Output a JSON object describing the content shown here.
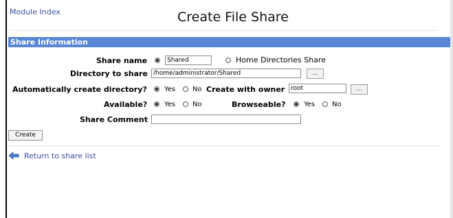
{
  "header": {
    "module_index_label": "Module Index",
    "title": "Create File Share"
  },
  "section": {
    "title": "Share Information"
  },
  "form": {
    "share_name": {
      "label": "Share name",
      "radio_named_selected": true,
      "value": "Shared",
      "home_dirs_label": "Home Directories Share"
    },
    "directory": {
      "label": "Directory to share",
      "value": "/home/administrator/Shared",
      "browse_label": "..."
    },
    "auto_create": {
      "label": "Automatically create directory?",
      "yes_label": "Yes",
      "no_label": "No",
      "selected": "Yes"
    },
    "owner": {
      "label": "Create with owner",
      "value": "root",
      "browse_label": "..."
    },
    "available": {
      "label": "Available?",
      "yes_label": "Yes",
      "no_label": "No",
      "selected": "Yes"
    },
    "browseable": {
      "label": "Browseable?",
      "yes_label": "Yes",
      "no_label": "No",
      "selected": "Yes"
    },
    "comment": {
      "label": "Share Comment",
      "value": ""
    }
  },
  "actions": {
    "create_label": "Create"
  },
  "footer": {
    "return_label": "Return to share list",
    "return_icon": "back-arrow-icon"
  },
  "colors": {
    "section_header_bg": "#5a86d6",
    "link": "#3b4fa0"
  }
}
